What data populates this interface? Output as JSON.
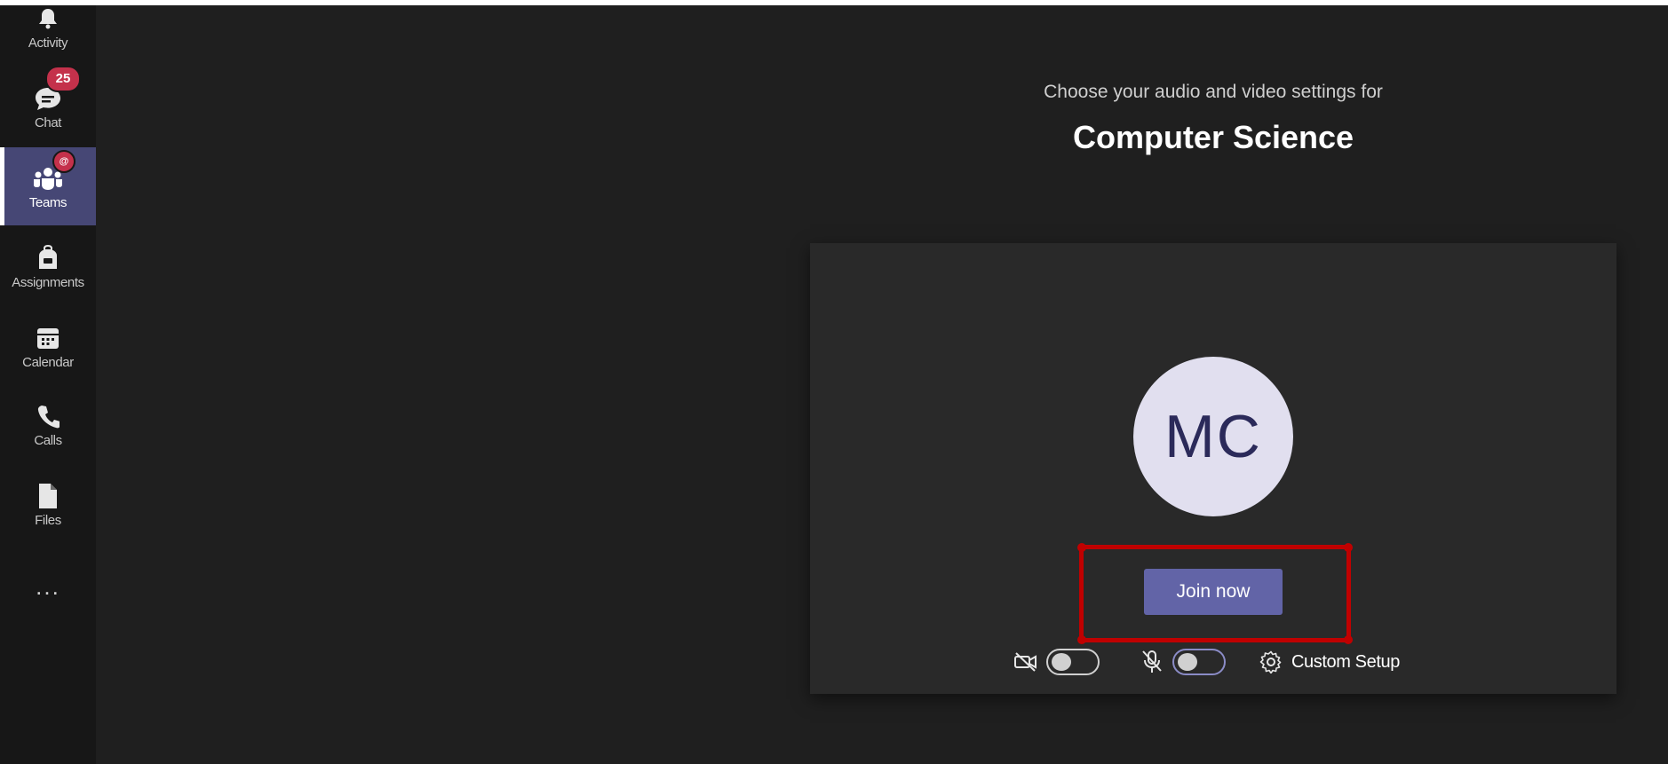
{
  "rail": {
    "items": [
      {
        "label": "Activity",
        "icon": "bell-icon"
      },
      {
        "label": "Chat",
        "icon": "chat-icon",
        "badge": "25"
      },
      {
        "label": "Teams",
        "icon": "teams-icon",
        "badge": "@",
        "active": true
      },
      {
        "label": "Assignments",
        "icon": "backpack-icon"
      },
      {
        "label": "Calendar",
        "icon": "calendar-icon"
      },
      {
        "label": "Calls",
        "icon": "phone-icon"
      },
      {
        "label": "Files",
        "icon": "file-icon"
      }
    ],
    "more_label": "..."
  },
  "prejoin": {
    "pretitle": "Choose your audio and video settings for",
    "title": "Computer Science",
    "avatar_initials": "MC",
    "join_label": "Join now",
    "video_toggle": "off",
    "mic_toggle": "off",
    "custom_setup_label": "Custom Setup"
  },
  "colors": {
    "accent": "#6264a7",
    "highlight": "#c00000",
    "badge": "#c4314b",
    "avatar_bg": "#e1dfef"
  }
}
